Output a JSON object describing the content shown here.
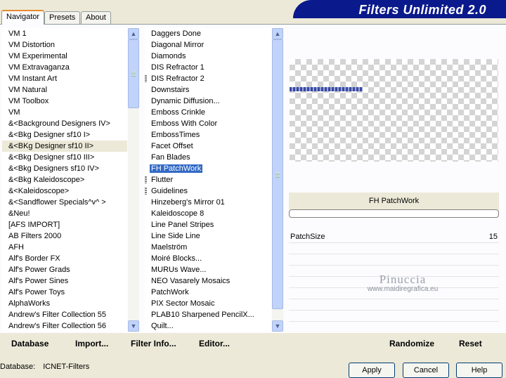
{
  "tabs": [
    "Navigator",
    "Presets",
    "About"
  ],
  "app_title": "Filters Unlimited 2.0",
  "categories": [
    "VM 1",
    "VM Distortion",
    "VM Experimental",
    "VM Extravaganza",
    "VM Instant Art",
    "VM Natural",
    "VM Toolbox",
    "VM",
    "&<Background Designers IV>",
    "&<Bkg Designer sf10 I>",
    "&<BKg Designer sf10 II>",
    "&<Bkg Designer sf10 III>",
    "&<Bkg Designers sf10 IV>",
    "&<Bkg Kaleidoscope>",
    "&<Kaleidoscope>",
    "&<Sandflower Specials^v^ >",
    "&Neu!",
    "[AFS IMPORT]",
    "AB Filters 2000",
    "AFH",
    "Alf's Border FX",
    "Alf's Power Grads",
    "Alf's Power Sines",
    "Alf's Power Toys",
    "AlphaWorks",
    "Andrew's Filter Collection 55",
    "Andrew's Filter Collection 56"
  ],
  "categories_selected": "&<BKg Designer sf10 II>",
  "filters": [
    "Daggers Done",
    "Diagonal Mirror",
    "Diamonds",
    "DIS Refractor 1",
    "DIS Refractor 2",
    "Downstairs",
    "Dynamic Diffusion...",
    "Emboss Crinkle",
    "Emboss With Color",
    "EmbossTimes",
    "Facet Offset",
    "Fan Blades",
    "FH PatchWork",
    "Flutter",
    "Guidelines",
    "Hinzeberg's Mirror 01",
    "Kaleidoscope 8",
    "Line Panel Stripes",
    "Line Side Line",
    "Maelström",
    "Moiré Blocks...",
    "MURUs Wave...",
    "NEO Vasarely Mosaics",
    "PatchWork",
    "PIX Sector Mosaic",
    "PLAB10 Sharpened PencilX...",
    "Quilt..."
  ],
  "filters_selected": "FH PatchWork",
  "filters_marked": [
    "DIS Refractor 2",
    "Flutter",
    "Guidelines"
  ],
  "filter_name": "FH PatchWork",
  "params": [
    {
      "label": "PatchSize",
      "value": "15"
    }
  ],
  "watermark": {
    "name": "Pinuccia",
    "site": "www.maidiregrafica.eu"
  },
  "buttons": {
    "database": "Database",
    "import": "Import...",
    "filter_info": "Filter Info...",
    "editor": "Editor...",
    "randomize": "Randomize",
    "reset": "Reset",
    "apply": "Apply",
    "cancel": "Cancel",
    "help": "Help"
  },
  "status": {
    "database_label": "Database:",
    "database_value": "ICNET-Filters"
  },
  "colors": {
    "banner": "#0a1a8c",
    "selection": "#316ac5"
  }
}
